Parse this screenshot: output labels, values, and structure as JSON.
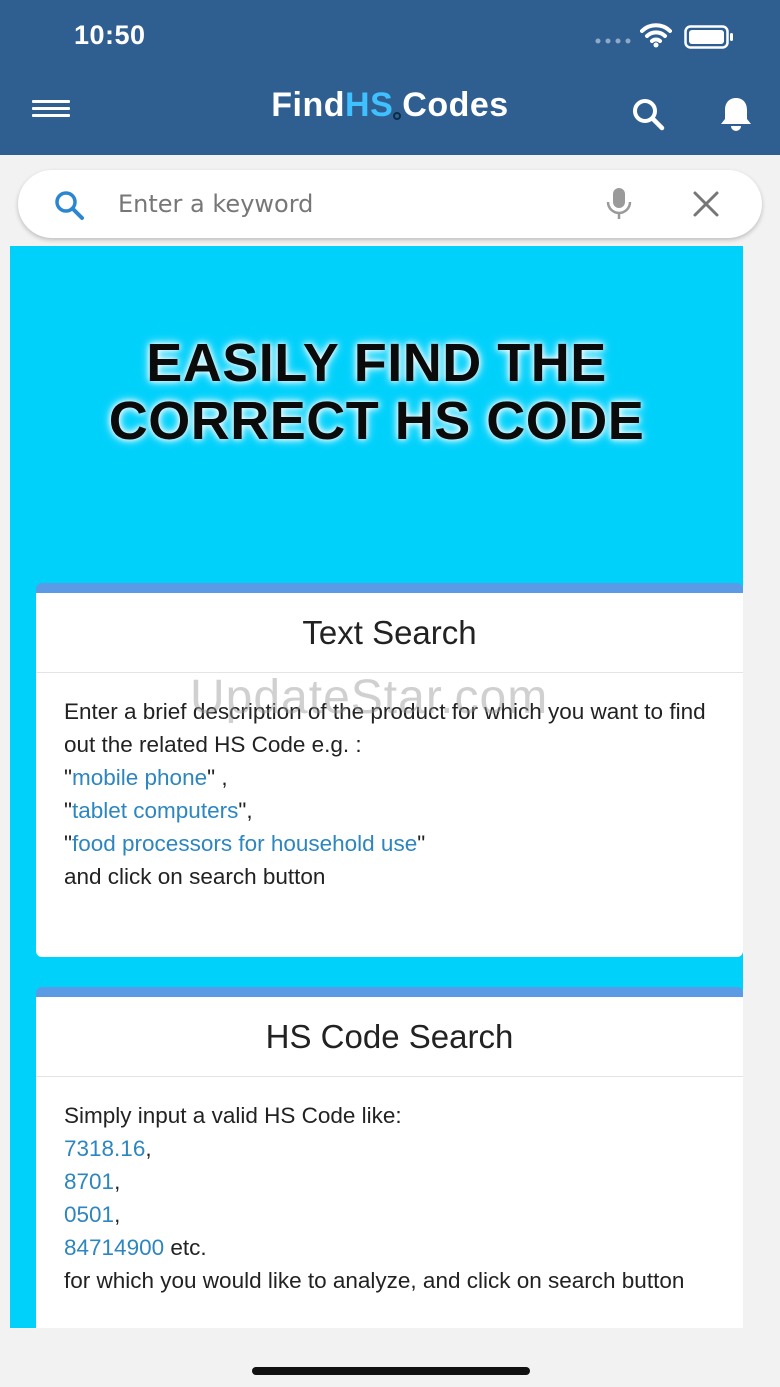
{
  "status_bar": {
    "time": "10:50"
  },
  "header": {
    "brand_prefix": "Find",
    "brand_highlight": "HS",
    "brand_suffix": "Codes"
  },
  "search": {
    "placeholder": "Enter a keyword",
    "value": ""
  },
  "hero": {
    "line1": "EASILY FIND THE",
    "line2": "CORRECT HS CODE"
  },
  "text_search_card": {
    "title": "Text Search",
    "intro": "Enter a brief description of the product for which you want to find out the related HS Code e.g. :",
    "examples": [
      "mobile phone",
      "tablet computers",
      "food processors for household use"
    ],
    "ex1_suffix": " ,",
    "ex2_suffix": ",",
    "outro": "and click on search button"
  },
  "hs_code_card": {
    "title": "HS Code Search",
    "intro": "Simply input a valid HS Code like:",
    "codes": [
      "7318.16",
      "8701",
      "0501",
      "84714900"
    ],
    "last_suffix": " etc.",
    "outro": "for which you would like to analyze, and click on search button"
  },
  "watermark": "UpdateStar.com",
  "colors": {
    "header_bg": "#2f5f91",
    "brand_accent": "#3fc0ff",
    "content_bg": "#00d1fb",
    "card_top": "#5b9be6",
    "link": "#2d86bf"
  }
}
